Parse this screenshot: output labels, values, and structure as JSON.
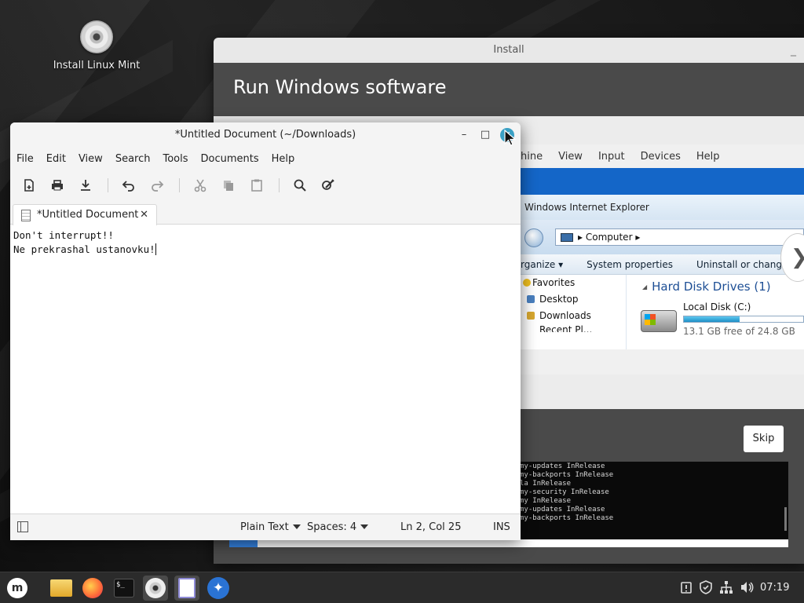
{
  "desktop": {
    "icon_label": "Install Linux Mint"
  },
  "installer": {
    "title": "Install",
    "minimize_glyph": "_",
    "heading": "Run Windows software",
    "skip_label": "Skip",
    "progress": 0.05,
    "vm": {
      "menu": [
        "hine",
        "View",
        "Input",
        "Devices",
        "Help"
      ],
      "ie_title": "Windows Internet Explorer",
      "address": "Computer",
      "next_glyph": "❯",
      "commands": [
        "rganize ▾",
        "System properties",
        "Uninstall or change a program"
      ],
      "nav": [
        "Favorites",
        "Desktop",
        "Downloads",
        "Recent Pl..."
      ],
      "drives_heading": "Hard Disk Drives (1)",
      "drive_name": "Local Disk (C:)",
      "drive_used": 0.47,
      "drive_free": "13.1 GB free of 24.8 GB"
    },
    "terminal_lines": [
      "my-updates InRelease",
      "my-backports InRelease",
      "la InRelease",
      "my-security InRelease",
      "my InRelease",
      "my-updates InRelease",
      "my-backports InRelease"
    ]
  },
  "editor": {
    "title": "*Untitled Document (~/Downloads)",
    "window_buttons": {
      "minimize": "–",
      "maximize": "□",
      "close": "✕"
    },
    "menu": [
      "File",
      "Edit",
      "View",
      "Search",
      "Tools",
      "Documents",
      "Help"
    ],
    "tab_label": "*Untitled Document",
    "tab_close": "✕",
    "content": [
      "Don't interrupt!!",
      "Ne prekrashal ustanovku!"
    ],
    "status": {
      "language": "Plain Text",
      "spaces": "Spaces: 4",
      "position": "Ln 2, Col 25",
      "mode": "INS"
    }
  },
  "taskbar": {
    "clock": "07:19",
    "mint_glyph": "m",
    "term_glyph": "$_"
  },
  "colors": {
    "installer_bg": "#4a4a4a",
    "accent": "#3584e4",
    "vm_blue": "#1466c8"
  }
}
